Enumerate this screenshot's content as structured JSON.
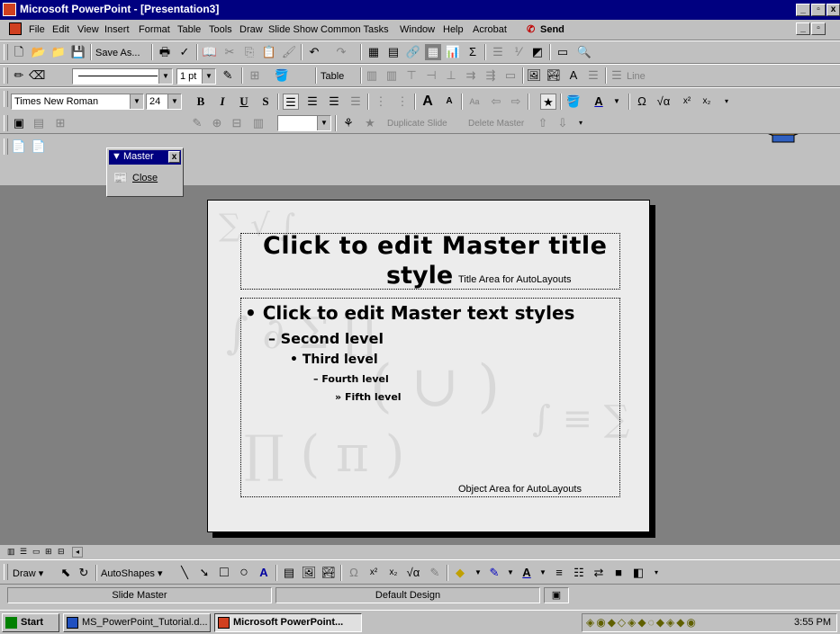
{
  "window": {
    "title": "Microsoft PowerPoint - [Presentation3]"
  },
  "menu": [
    "File",
    "Edit",
    "View",
    "Insert",
    "Format",
    "Table",
    "Tools",
    "Draw",
    "Slide Show",
    "Common Tasks",
    "Window",
    "Help",
    "Acrobat",
    "Send"
  ],
  "standard_toolbar": {
    "save_as": "Save As..."
  },
  "tables_toolbar": {
    "line_weight": "1 pt",
    "table_menu": "Table",
    "line_label": "Line"
  },
  "formatting_toolbar": {
    "font": "Times New Roman",
    "size": "24"
  },
  "master_toolbar": {
    "duplicate_slide": "Duplicate Slide",
    "delete_master": "Delete Master",
    "floating_title": "Master",
    "close_label": "Close"
  },
  "slide": {
    "title_line1": "Click to edit Master title",
    "title_line2": "style",
    "title_area_note": "Title Area for AutoLayouts",
    "bullets": [
      "Click to edit Master text styles",
      "Second level",
      "Third level",
      "Fourth level",
      "Fifth level"
    ],
    "object_area_note": "Object Area for AutoLayouts"
  },
  "drawing_toolbar": {
    "draw": "Draw",
    "autoshapes": "AutoShapes"
  },
  "status_bar": {
    "view": "Slide Master",
    "design": "Default Design"
  },
  "taskbar": {
    "start": "Start",
    "tasks": [
      "MS_PowerPoint_Tutorial.d...",
      "Microsoft PowerPoint..."
    ],
    "clock": "3:55 PM"
  }
}
